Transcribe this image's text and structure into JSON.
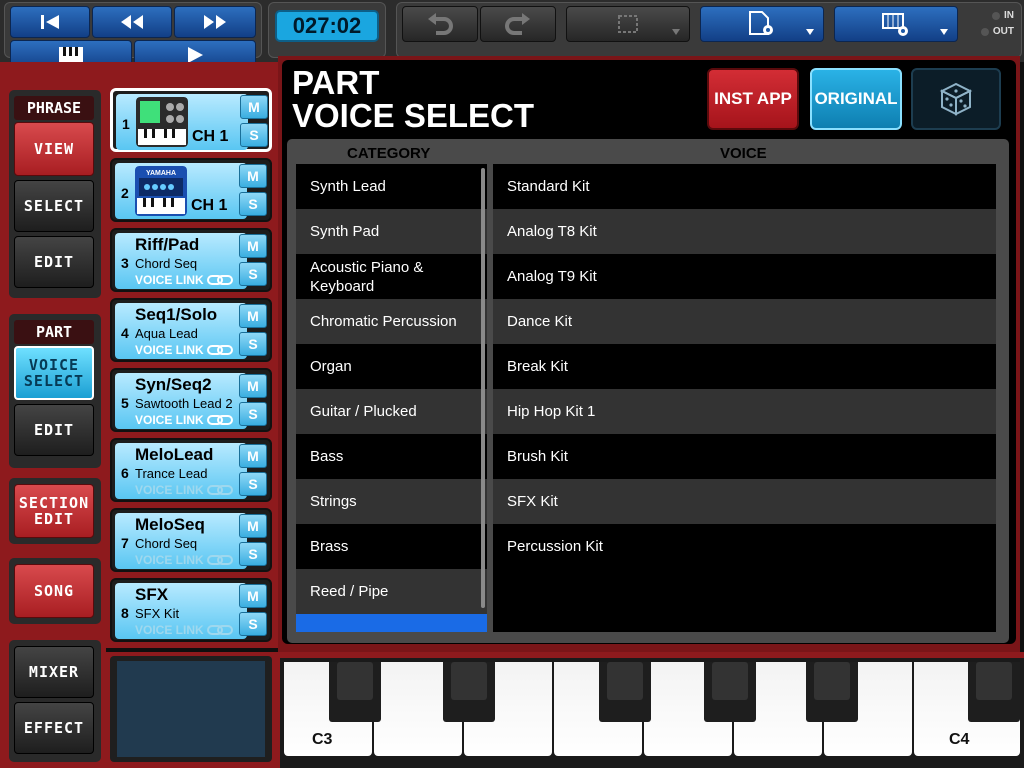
{
  "transport": {
    "time": "027:02"
  },
  "io": {
    "in": "IN",
    "out": "OUT"
  },
  "sidebar": {
    "phrase_label": "PHRASE",
    "view": "VIEW",
    "select": "SELECT",
    "edit1": "EDIT",
    "part_label": "PART",
    "voice_select": "VOICE SELECT",
    "edit2": "EDIT",
    "section_edit": "SECTION EDIT",
    "song": "SONG",
    "mixer": "MIXER",
    "effect": "EFFECT"
  },
  "parts": [
    {
      "num": "1",
      "name": "",
      "voice": "",
      "channel": "CH 1",
      "m": "M",
      "s": "S",
      "link": ""
    },
    {
      "num": "2",
      "name": "",
      "voice": "",
      "channel": "CH 1",
      "m": "M",
      "s": "S",
      "link": ""
    },
    {
      "num": "3",
      "name": "Riff/Pad",
      "voice": "Chord Seq",
      "channel": "",
      "m": "M",
      "s": "S",
      "link": "VOICE LINK"
    },
    {
      "num": "4",
      "name": "Seq1/Solo",
      "voice": "Aqua Lead",
      "channel": "",
      "m": "M",
      "s": "S",
      "link": "VOICE LINK"
    },
    {
      "num": "5",
      "name": "Syn/Seq2",
      "voice": "Sawtooth Lead 2",
      "channel": "",
      "m": "M",
      "s": "S",
      "link": "VOICE LINK"
    },
    {
      "num": "6",
      "name": "MeloLead",
      "voice": "Trance Lead",
      "channel": "",
      "m": "M",
      "s": "S",
      "link": "VOICE LINK"
    },
    {
      "num": "7",
      "name": "MeloSeq",
      "voice": "Chord Seq",
      "channel": "",
      "m": "M",
      "s": "S",
      "link": "VOICE LINK"
    },
    {
      "num": "8",
      "name": "SFX",
      "voice": "SFX Kit",
      "channel": "",
      "m": "M",
      "s": "S",
      "link": "VOICE LINK"
    }
  ],
  "part2_brand": "YAMAHA",
  "header": {
    "title_line1": "PART",
    "title_line2": "VOICE SELECT",
    "inst_app": "INST APP",
    "original": "ORIGINAL"
  },
  "list": {
    "category_header": "CATEGORY",
    "voice_header": "VOICE",
    "categories": [
      "Synth Lead",
      "Synth Pad",
      "Acoustic Piano & Keyboard",
      "Chromatic Percussion",
      "Organ",
      "Guitar / Plucked",
      "Bass",
      "Strings",
      "Brass",
      "Reed / Pipe"
    ],
    "voices": [
      "Standard Kit",
      "Analog T8 Kit",
      "Analog T9 Kit",
      "Dance Kit",
      "Break Kit",
      "Hip Hop Kit 1",
      "Brush Kit",
      "SFX Kit",
      "Percussion Kit"
    ]
  },
  "keyboard": {
    "low": "C3",
    "high": "C4"
  },
  "colors": {
    "accent_red": "#8e1a1d",
    "accent_blue": "#1aa6e0",
    "selected_category": "#1a6be6"
  }
}
